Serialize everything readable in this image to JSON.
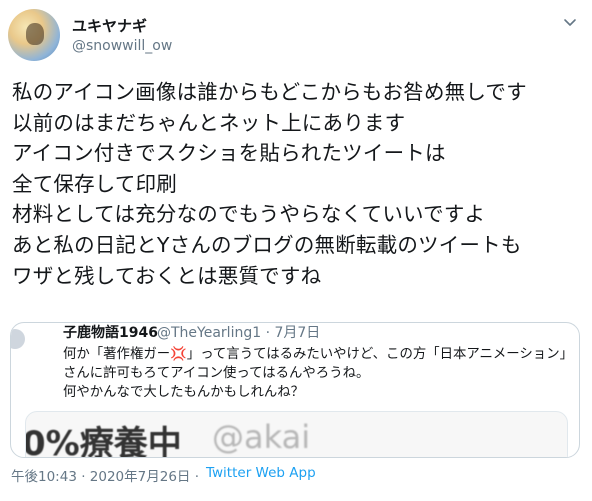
{
  "author": {
    "display_name": "ユキヤナギ",
    "handle": "@snowwill_ow"
  },
  "tweet": {
    "text": "私のアイコン画像は誰からもどこからもお咎め無しです\n以前のはまだちゃんとネット上にあります\nアイコン付きでスクショを貼られたツイートは\n全て保存して印刷\n材料としては充分なのでもうやらなくていいですよ\nあと私の日記とYさんのブログの無断転載のツイートも\nワザと残しておくとは悪質ですね"
  },
  "quoted_tweet": {
    "name": "子鹿物語1946",
    "handle_and_date": "@TheYearling1 · 7月7日",
    "text": "何か「著作権ガー💢」って言うてはるみたいやけど、この方「日本アニメーション」さんに許可もろてアイコン使ってはるんやろうね。\n何やかんなで大したもんかもしれんね？",
    "image_text_1": "0%療養中",
    "image_text_2": "@akai"
  },
  "meta": {
    "timestamp": "午後10:43 · 2020年7月26日 ·",
    "source": "Twitter Web App"
  },
  "icons": {
    "menu": "chevron-down-icon"
  },
  "colors": {
    "text": "#14171a",
    "secondary": "#657786",
    "link": "#1da1f2",
    "border": "#ccd6dd"
  }
}
